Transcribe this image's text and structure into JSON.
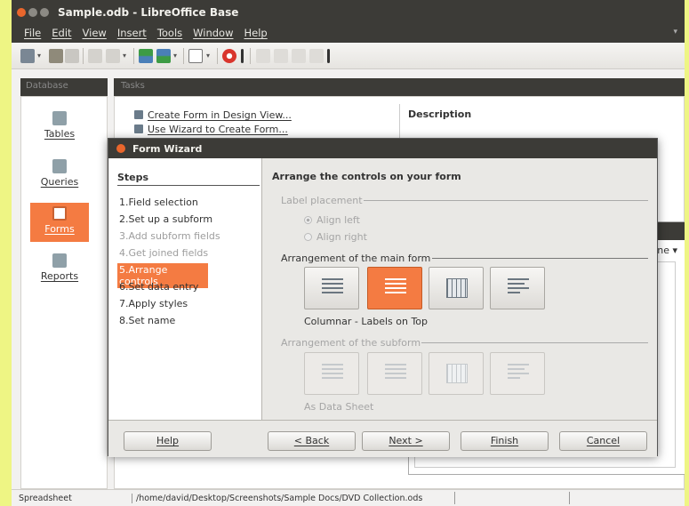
{
  "window": {
    "title": "Sample.odb - LibreOffice Base"
  },
  "menu": [
    "File",
    "Edit",
    "View",
    "Insert",
    "Tools",
    "Window",
    "Help"
  ],
  "database_pane": {
    "header": "Database",
    "items": [
      {
        "label": "Tables",
        "icon": "tables-icon"
      },
      {
        "label": "Queries",
        "icon": "queries-icon"
      },
      {
        "label": "Forms",
        "icon": "forms-icon",
        "active": true
      },
      {
        "label": "Reports",
        "icon": "reports-icon"
      }
    ]
  },
  "tasks_pane": {
    "header": "Tasks",
    "tasks": [
      "Create Form in Design View...",
      "Use Wizard to Create Form..."
    ],
    "description_label": "Description",
    "forms_dropdown": "ne"
  },
  "wizard": {
    "title": "Form Wizard",
    "steps_title": "Steps",
    "steps": [
      {
        "label": "1.Field selection",
        "state": "normal"
      },
      {
        "label": "2.Set up a subform",
        "state": "normal"
      },
      {
        "label": "3.Add subform fields",
        "state": "disabled"
      },
      {
        "label": "4.Get joined fields",
        "state": "disabled"
      },
      {
        "label": "5.Arrange controls",
        "state": "active"
      },
      {
        "label": "6.Set data entry",
        "state": "normal"
      },
      {
        "label": "7.Apply styles",
        "state": "normal"
      },
      {
        "label": "8.Set name",
        "state": "normal"
      }
    ],
    "heading": "Arrange the controls on your form",
    "label_placement": {
      "legend": "Label placement",
      "options": [
        "Align left",
        "Align right"
      ]
    },
    "main_form": {
      "legend": "Arrangement of the main form",
      "caption": "Columnar - Labels on Top"
    },
    "subform": {
      "legend": "Arrangement of the subform",
      "caption": "As Data Sheet"
    },
    "buttons": {
      "help": "Help",
      "back": "< Back",
      "next": "Next >",
      "finish": "Finish",
      "cancel": "Cancel"
    }
  },
  "status": {
    "doc_type": "Spreadsheet",
    "path": "/home/david/Desktop/Screenshots/Sample Docs/DVD Collection.ods"
  },
  "colors": {
    "accent": "#f47b42",
    "titlebar": "#3c3b37",
    "background": "#eef584"
  }
}
